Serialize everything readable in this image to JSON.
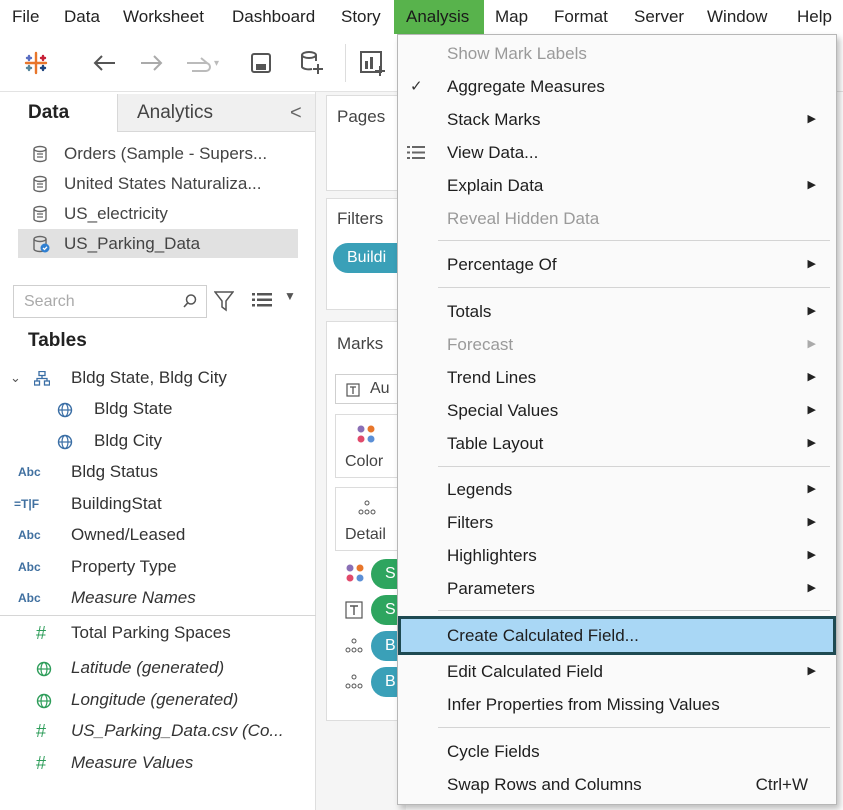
{
  "menubar": {
    "items": [
      "File",
      "Data",
      "Worksheet",
      "Dashboard",
      "Story",
      "Analysis",
      "Map",
      "Format",
      "Server",
      "Window",
      "Help"
    ]
  },
  "left_pane": {
    "tab_data": "Data",
    "tab_analytics": "Analytics",
    "data_sources": [
      "Orders (Sample - Supers...",
      "United States Naturaliza...",
      "US_electricity",
      "US_Parking_Data"
    ],
    "search_placeholder": "Search",
    "tables_heading": "Tables",
    "fields": [
      {
        "label": "Bldg State, Bldg City",
        "icon": "hierarchy-icon"
      },
      {
        "label": "Bldg State",
        "icon": "globe-icon"
      },
      {
        "label": "Bldg City",
        "icon": "globe-icon"
      },
      {
        "label": "Bldg Status",
        "icon": "Abc"
      },
      {
        "label": "BuildingStat",
        "icon": "=T|F"
      },
      {
        "label": "Owned/Leased",
        "icon": "Abc"
      },
      {
        "label": "Property Type",
        "icon": "Abc"
      },
      {
        "label": "Measure Names",
        "icon": "Abc"
      },
      {
        "label": "Total Parking Spaces",
        "icon": "#"
      },
      {
        "label": "Latitude (generated)",
        "icon": "globe-icon"
      },
      {
        "label": "Longitude (generated)",
        "icon": "globe-icon"
      },
      {
        "label": "US_Parking_Data.csv (Co...",
        "icon": "#"
      },
      {
        "label": "Measure Values",
        "icon": "#"
      }
    ]
  },
  "shelves": {
    "pages": "Pages",
    "filters": "Filters",
    "filter_pill": "Buildi",
    "marks": "Marks",
    "mark_type": "Au",
    "color": "Color",
    "detail": "Detail",
    "pill_letters": [
      "S",
      "S",
      "B",
      "B"
    ]
  },
  "analysis_menu": {
    "items": [
      {
        "label": "Show Mark Labels",
        "disabled": true
      },
      {
        "label": "Aggregate Measures",
        "checked": true
      },
      {
        "label": "Stack Marks",
        "submenu": true
      },
      {
        "label": "View Data..."
      },
      {
        "label": "Explain Data",
        "submenu": true
      },
      {
        "label": "Reveal Hidden Data",
        "disabled": true
      },
      {
        "label": "Percentage Of",
        "submenu": true
      },
      {
        "label": "Totals",
        "submenu": true
      },
      {
        "label": "Forecast",
        "submenu": true,
        "disabled": true
      },
      {
        "label": "Trend Lines",
        "submenu": true
      },
      {
        "label": "Special Values",
        "submenu": true
      },
      {
        "label": "Table Layout",
        "submenu": true
      },
      {
        "label": "Legends",
        "submenu": true
      },
      {
        "label": "Filters",
        "submenu": true
      },
      {
        "label": "Highlighters",
        "submenu": true
      },
      {
        "label": "Parameters",
        "submenu": true
      },
      {
        "label": "Create Calculated Field...",
        "highlighted": true
      },
      {
        "label": "Edit Calculated Field",
        "submenu": true
      },
      {
        "label": "Infer Properties from Missing Values"
      },
      {
        "label": "Cycle Fields"
      },
      {
        "label": "Swap Rows and Columns",
        "shortcut": "Ctrl+W"
      }
    ]
  },
  "colors": {
    "active_menu": "#58b34c",
    "highlight": "#a9d7f5",
    "highlight_border": "#1e4a52",
    "pill_teal": "#3aa0b8",
    "pill_green": "#2ea55f"
  }
}
